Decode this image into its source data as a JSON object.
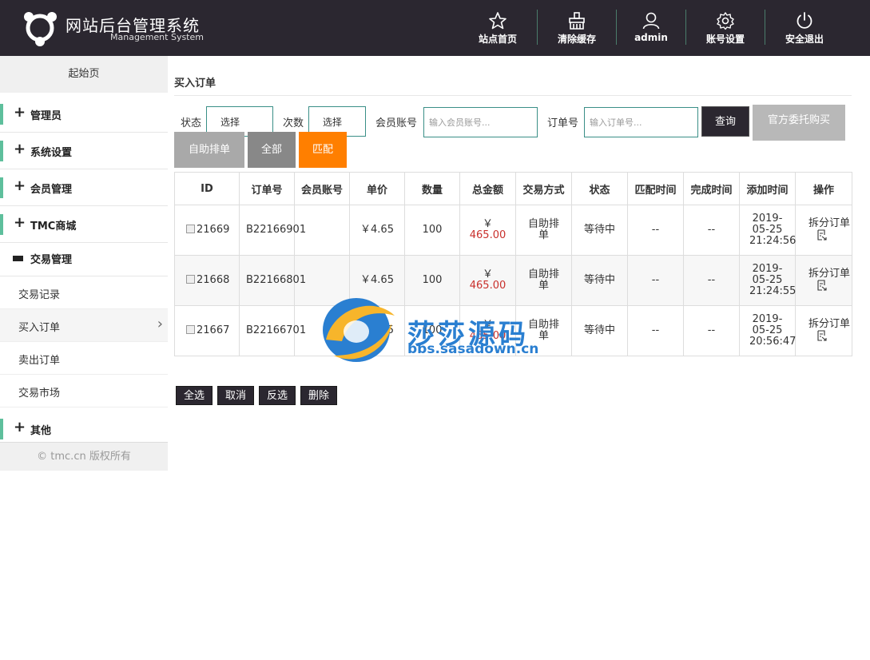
{
  "header": {
    "title": "网站后台管理系统",
    "subtitle": "Management System",
    "nav": [
      {
        "label": "站点首页",
        "icon": "star-icon"
      },
      {
        "label": "清除缓存",
        "icon": "broom-icon"
      },
      {
        "label": "admin",
        "icon": "user-icon"
      },
      {
        "label": "账号设置",
        "icon": "gear-icon"
      },
      {
        "label": "安全退出",
        "icon": "power-icon"
      }
    ]
  },
  "sidebar": {
    "start_page": "起始页",
    "menus": [
      {
        "label": "管理员"
      },
      {
        "label": "系统设置"
      },
      {
        "label": "会员管理"
      },
      {
        "label": "TMC商城"
      },
      {
        "label": "交易管理"
      },
      {
        "label": "其他"
      }
    ],
    "sub_items": [
      {
        "label": "交易记录"
      },
      {
        "label": "买入订单"
      },
      {
        "label": "卖出订单"
      },
      {
        "label": "交易市场"
      }
    ],
    "copyright": "© tmc.cn 版权所有"
  },
  "main": {
    "page_title": "买入订单",
    "filters": {
      "status_label": "状态",
      "status_value": "选择",
      "count_label": "次数",
      "count_value": "选择",
      "member_label": "会员账号",
      "member_placeholder": "输入会员账号...",
      "order_label": "订单号",
      "order_placeholder": "输入订单号...",
      "query_button": "查询",
      "official_button": "官方委托购买"
    },
    "tabs": [
      {
        "label": "自助排单"
      },
      {
        "label": "全部"
      },
      {
        "label": "匹配"
      }
    ],
    "table": {
      "headers": [
        "ID",
        "订单号",
        "会员账号",
        "单价",
        "数量",
        "总金额",
        "交易方式",
        "状态",
        "匹配时间",
        "完成时间",
        "添加时间",
        "操作"
      ],
      "rows": [
        {
          "id": "21669",
          "order_no": "B22166901",
          "member": "",
          "price": "￥4.65",
          "qty": "100",
          "total_symbol": "￥",
          "total": "465.00",
          "method": "自助排单",
          "status": "等待中",
          "match_time": "--",
          "done_time": "--",
          "add_date": "2019-05-25",
          "add_time": "21:24:56",
          "op": "拆分订单"
        },
        {
          "id": "21668",
          "order_no": "B22166801",
          "member": "",
          "price": "￥4.65",
          "qty": "100",
          "total_symbol": "￥",
          "total": "465.00",
          "method": "自助排单",
          "status": "等待中",
          "match_time": "--",
          "done_time": "--",
          "add_date": "2019-05-25",
          "add_time": "21:24:55",
          "op": "拆分订单"
        },
        {
          "id": "21667",
          "order_no": "B22166701",
          "member": "",
          "price": "￥4.65",
          "qty": "100",
          "total_symbol": "￥",
          "total": "465.00",
          "method": "自助排单",
          "status": "等待中",
          "match_time": "--",
          "done_time": "--",
          "add_date": "2019-05-25",
          "add_time": "20:56:47",
          "op": "拆分订单"
        }
      ]
    },
    "bottom_buttons": [
      {
        "label": "全选"
      },
      {
        "label": "取消"
      },
      {
        "label": "反选"
      },
      {
        "label": "删除"
      }
    ]
  },
  "watermark": {
    "text": "莎莎源码",
    "url": "bbs.sasadown.cn"
  },
  "colors": {
    "header_bg": "#2b2730",
    "accent_green": "#5ebf9c",
    "tab_gray": "#a9a9a9",
    "tab_dark_gray": "#888888",
    "tab_orange": "#ff7f00",
    "amount_red": "#c9302c",
    "status_blue": "#3a7bc8"
  }
}
